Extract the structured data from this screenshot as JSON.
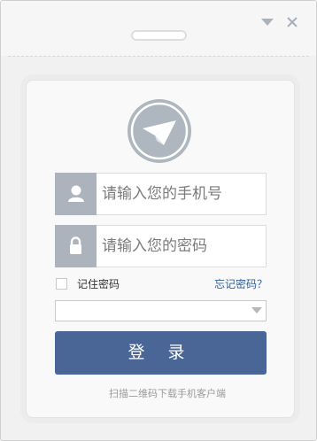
{
  "window": {
    "minimize_icon": "triangle-down-icon",
    "close_icon": "close-icon"
  },
  "logo": {
    "icon": "paper-plane-icon",
    "color": "#aeb6bf"
  },
  "form": {
    "phone": {
      "icon": "user-icon",
      "placeholder": "请输入您的手机号",
      "value": ""
    },
    "password": {
      "icon": "lock-icon",
      "placeholder": "请输入您的密码",
      "value": ""
    },
    "remember_label": "记住密码",
    "forgot_label": "忘记密码？",
    "account_select_value": "",
    "login_label": "登 录",
    "scan_text": "扫描二维码下载手机客户端"
  },
  "colors": {
    "accent": "#4a6696",
    "link": "#2f5fa0",
    "icon_bg": "#acb3bc"
  }
}
